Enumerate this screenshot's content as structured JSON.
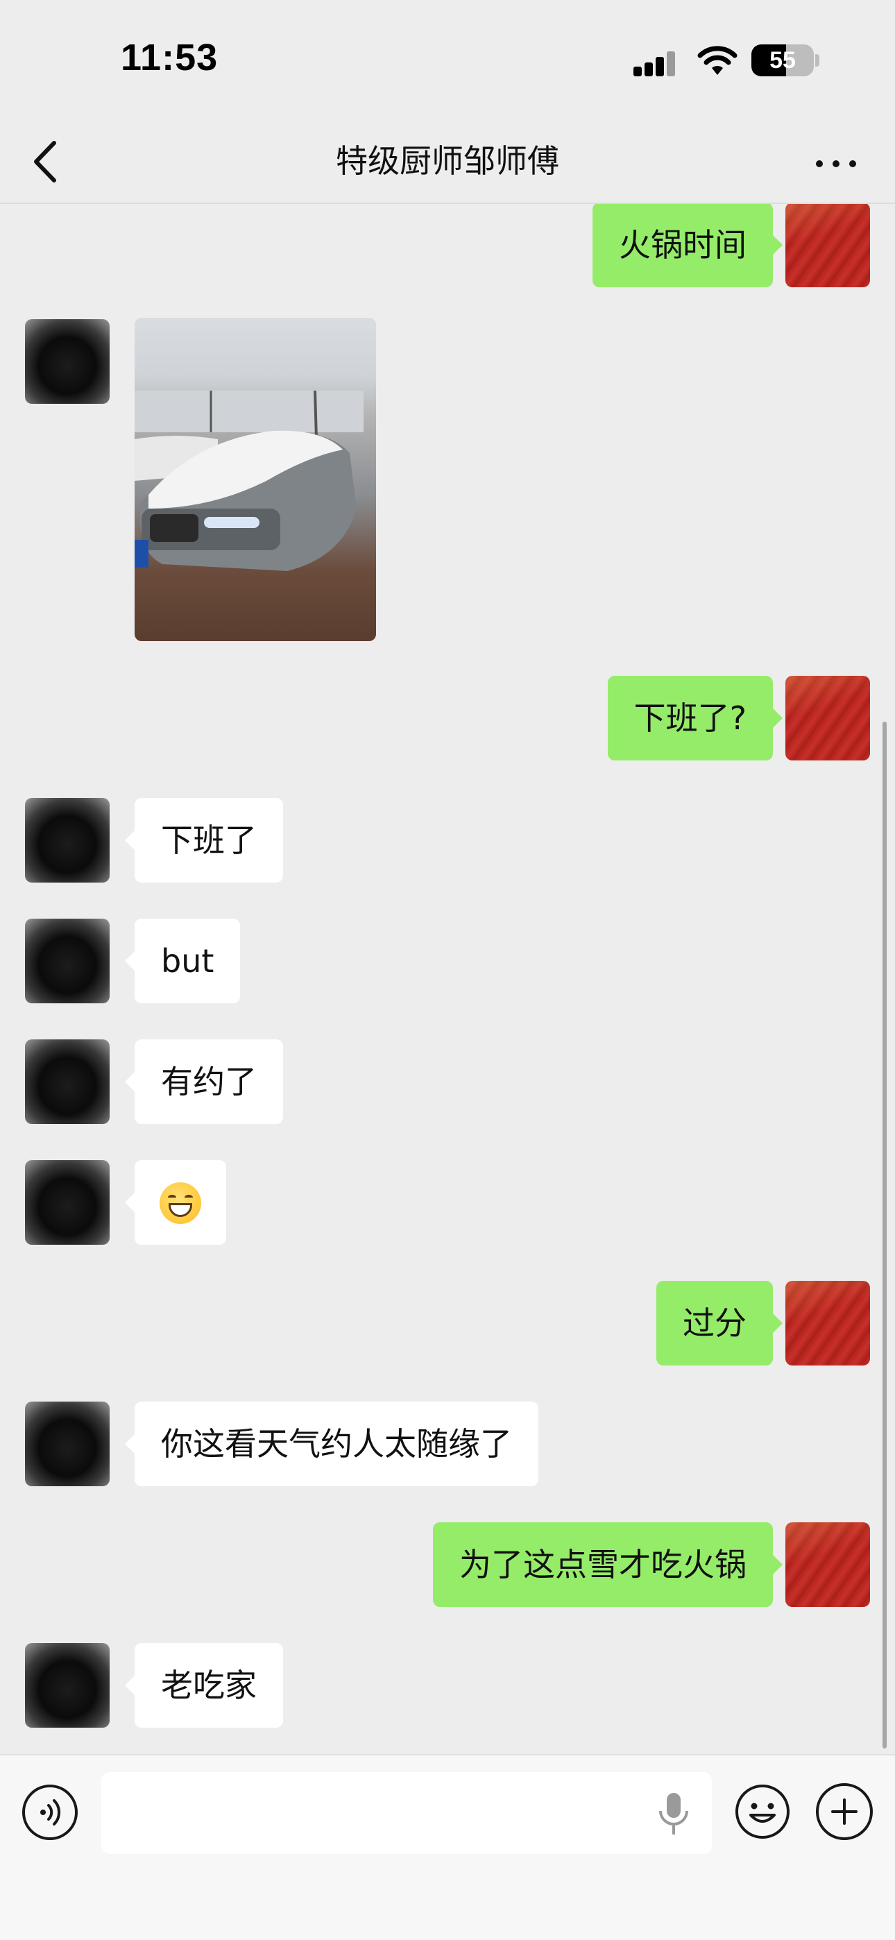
{
  "status_bar": {
    "time": "11:53",
    "battery_level": "55",
    "icons": [
      "cellular-signal-icon",
      "wifi-icon",
      "battery-icon"
    ]
  },
  "header": {
    "title": "特级厨师邹师傅",
    "back_icon": "chevron-left-icon",
    "more_icon": "more-dots-icon"
  },
  "messages": [
    {
      "from": "me",
      "type": "text",
      "text": "火锅时间"
    },
    {
      "from": "other",
      "type": "image",
      "image_desc": "snow-covered-car-photo"
    },
    {
      "from": "me",
      "type": "text",
      "text": "下班了?"
    },
    {
      "from": "other",
      "type": "text",
      "text": "下班了"
    },
    {
      "from": "other",
      "type": "text",
      "text": "but"
    },
    {
      "from": "other",
      "type": "text",
      "text": "有约了"
    },
    {
      "from": "other",
      "type": "emoji",
      "emoji": "grinning-face-emoji"
    },
    {
      "from": "me",
      "type": "text",
      "text": "过分"
    },
    {
      "from": "other",
      "type": "text",
      "text": "你这看天气约人太随缘了"
    },
    {
      "from": "me",
      "type": "text",
      "text": "为了这点雪才吃火锅"
    },
    {
      "from": "other",
      "type": "text",
      "text": "老吃家"
    }
  ],
  "input_bar": {
    "placeholder": "",
    "icons": [
      "voice-icon",
      "microphone-icon",
      "emoji-icon",
      "plus-icon"
    ]
  },
  "colors": {
    "background": "#ededed",
    "outgoing_bubble": "#95ec69",
    "incoming_bubble": "#ffffff"
  }
}
